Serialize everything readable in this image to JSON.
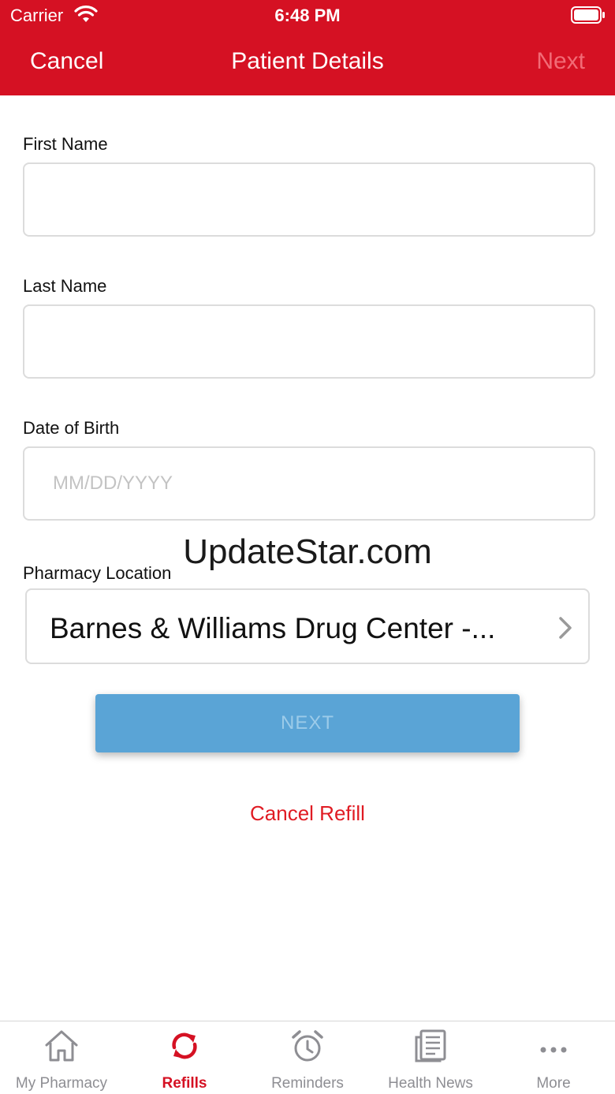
{
  "status_bar": {
    "carrier": "Carrier",
    "time": "6:48 PM"
  },
  "nav": {
    "cancel_label": "Cancel",
    "title": "Patient Details",
    "next_label": "Next"
  },
  "form": {
    "first_name": {
      "label": "First Name",
      "value": "",
      "placeholder": ""
    },
    "last_name": {
      "label": "Last Name",
      "value": "",
      "placeholder": ""
    },
    "dob": {
      "label": "Date of Birth",
      "value": "",
      "placeholder": "MM/DD/YYYY"
    },
    "pharmacy": {
      "label": "Pharmacy Location",
      "value": "Barnes & Williams Drug Center -..."
    }
  },
  "watermark": "UpdateStar.com",
  "next_button_label": "NEXT",
  "cancel_refill_label": "Cancel Refill",
  "tabs": [
    {
      "label": "My Pharmacy",
      "icon": "home-icon",
      "active": false
    },
    {
      "label": "Refills",
      "icon": "refresh-icon",
      "active": true
    },
    {
      "label": "Reminders",
      "icon": "alarm-clock-icon",
      "active": false
    },
    {
      "label": "Health News",
      "icon": "newspaper-icon",
      "active": false
    },
    {
      "label": "More",
      "icon": "more-icon",
      "active": false
    }
  ],
  "colors": {
    "brand_red": "#d51123",
    "next_button_blue": "#5aa4d6",
    "inactive_gray": "#8e8e93"
  }
}
